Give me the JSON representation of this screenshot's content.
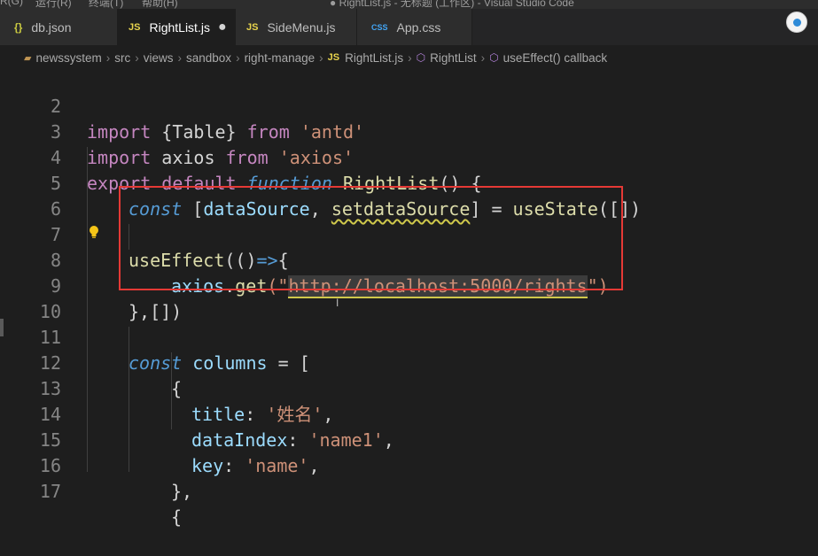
{
  "window": {
    "menu_items": [
      "R(G)",
      "运行(R)",
      "终端(T)",
      "帮助(H)"
    ],
    "title": "● RightList.js - 无标题 (工作区) - Visual Studio Code"
  },
  "tabs": [
    {
      "label": "db.json",
      "icon": "{}",
      "icon_name": "json-icon"
    },
    {
      "label": "RightList.js",
      "icon": "JS",
      "icon_name": "js-icon",
      "active": true,
      "dirty": true
    },
    {
      "label": "SideMenu.js",
      "icon": "JS",
      "icon_name": "js-icon"
    },
    {
      "label": "App.css",
      "icon": "CSS",
      "icon_name": "css-icon"
    }
  ],
  "breadcrumb": {
    "segments": [
      "newssystem",
      "src",
      "views",
      "sandbox",
      "right-manage"
    ],
    "file_icon": "JS",
    "file": "RightList.js",
    "symbol1": "RightList",
    "symbol2": "useEffect() callback"
  },
  "editor": {
    "line_numbers": [
      "2",
      "3",
      "4",
      "5",
      "6",
      "7",
      "8",
      "9",
      "10",
      "11",
      "12",
      "13",
      "14",
      "15",
      "16",
      "17"
    ],
    "lines": [
      {
        "n": "2",
        "t": [
          "import",
          " {Table} ",
          "from",
          " 'antd'"
        ]
      },
      {
        "n": "3",
        "t": [
          "import",
          " axios ",
          "from",
          " 'axios'"
        ]
      },
      {
        "n": "4",
        "t": [
          "export",
          " ",
          "default",
          " ",
          "function",
          " ",
          "RightList",
          "() {"
        ]
      },
      {
        "n": "5",
        "t": [
          "const",
          " [",
          "dataSource",
          ", ",
          "setdataSource",
          "] = ",
          "useState",
          "([])"
        ]
      },
      {
        "n": "7",
        "t": [
          "useEffect",
          "(()",
          "=>",
          "{"
        ]
      },
      {
        "n": "8",
        "t": [
          "axios",
          ".",
          "get",
          "(\"",
          "http://localhost:5000/rights",
          "\")"
        ]
      },
      {
        "n": "9",
        "t": [
          "},[])"
        ]
      },
      {
        "n": "11",
        "t": [
          "const",
          " ",
          "columns",
          " ",
          "=",
          " ["
        ]
      },
      {
        "n": "12",
        "t": [
          "{"
        ]
      },
      {
        "n": "13",
        "t": [
          "title",
          ": ",
          "'姓名'",
          ","
        ]
      },
      {
        "n": "14",
        "t": [
          "dataIndex",
          ": ",
          "'name1'",
          ","
        ]
      },
      {
        "n": "15",
        "t": [
          "key",
          ": ",
          "'name'",
          ","
        ]
      },
      {
        "n": "16",
        "t": [
          "},"
        ]
      },
      {
        "n": "17",
        "t": [
          "{"
        ]
      }
    ]
  },
  "colors": {
    "highlight_box": "#e53935",
    "keyword": "#c586c0",
    "string": "#ce9178",
    "function": "#dcdcaa",
    "variable": "#9cdcfe",
    "storage": "#569cd6"
  }
}
